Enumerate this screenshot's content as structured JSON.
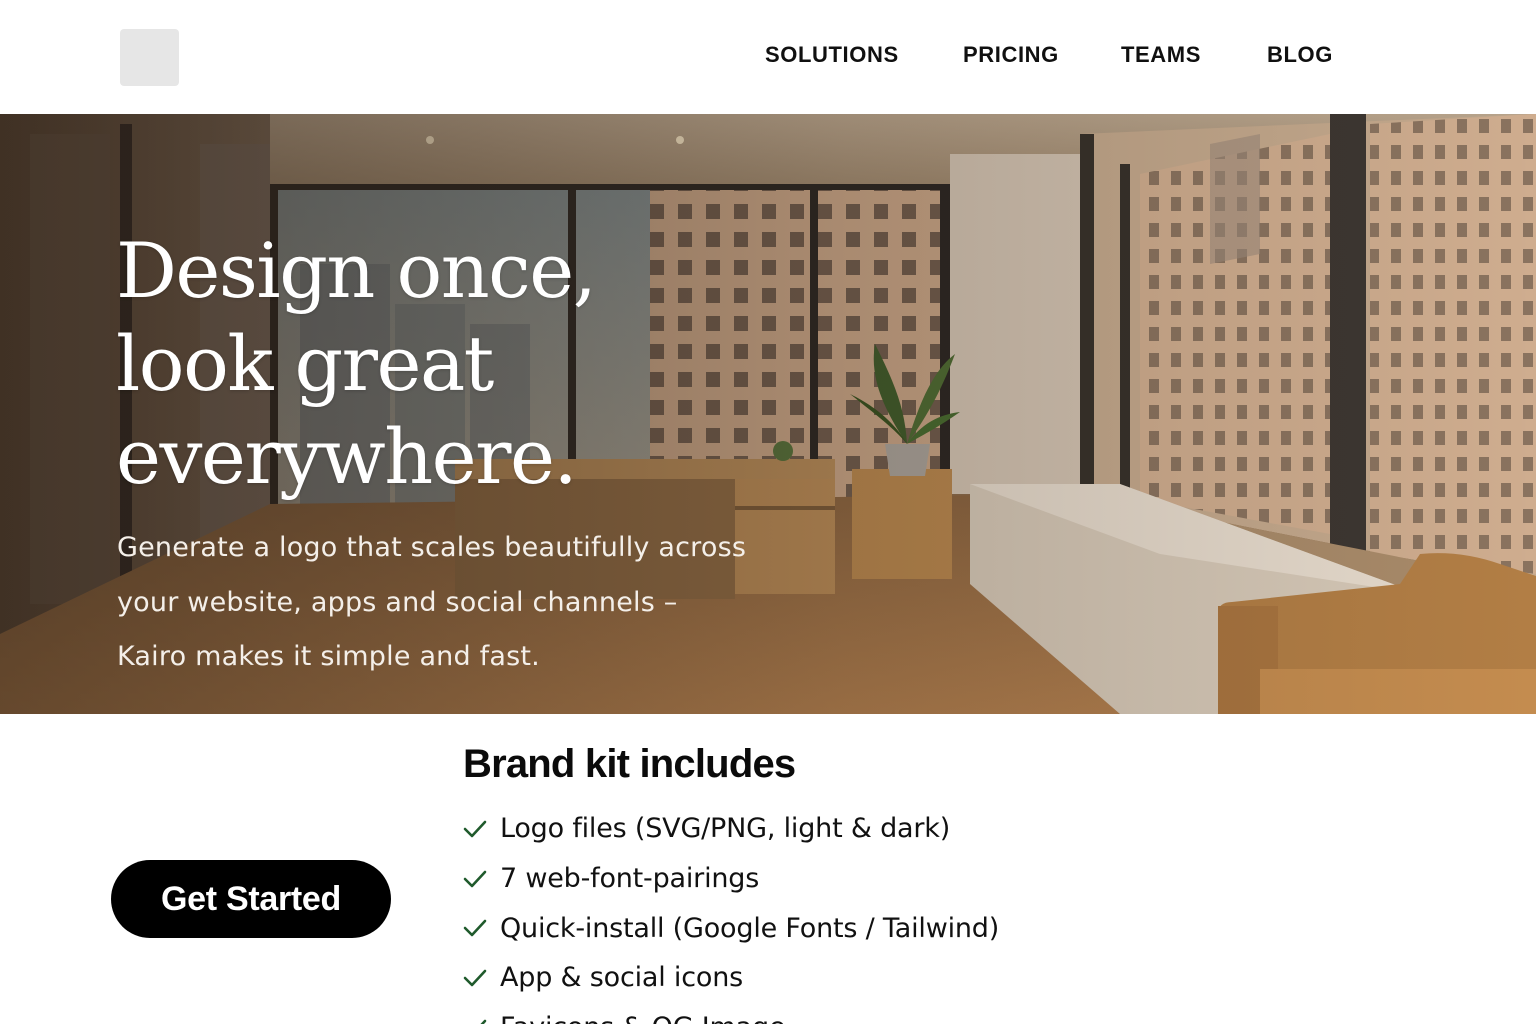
{
  "header": {
    "logo": "logo-placeholder",
    "nav": [
      {
        "label": "SOLUTIONS"
      },
      {
        "label": "PRICING"
      },
      {
        "label": "TEAMS"
      },
      {
        "label": "BLOG"
      }
    ]
  },
  "hero": {
    "title_lines": [
      "Design once,",
      "look great",
      "everywhere."
    ],
    "subtitle_lines": [
      "Generate a logo that scales beautifully across",
      "your website, apps and social channels –",
      "Kairo makes it simple and fast."
    ],
    "background": "office-interior-photo"
  },
  "cta": {
    "label": "Get Started"
  },
  "kit": {
    "title": "Brand kit includes",
    "items": [
      "Logo files (SVG/PNG, light & dark)",
      "7 web-font-pairings",
      "Quick-install (Google Fonts / Tailwind)",
      "App & social icons",
      "Favicons & OG Image"
    ],
    "check_color": "#1f5a2c"
  },
  "colors": {
    "cta_bg": "#000000",
    "cta_text": "#ffffff",
    "logo_placeholder": "#e6e6e6"
  }
}
